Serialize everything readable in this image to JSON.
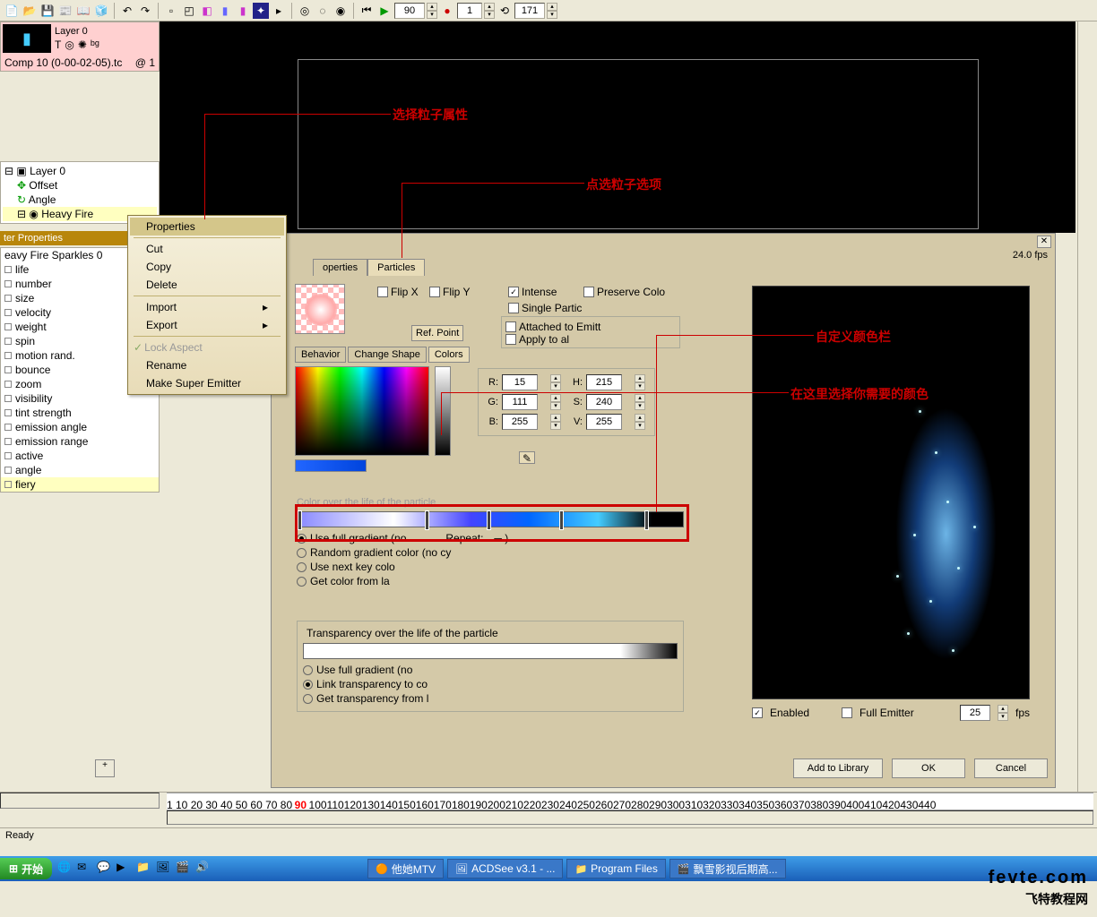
{
  "toolbar": {
    "frame_input": "90",
    "rec_input": "1",
    "frame2": "171"
  },
  "layer_panel": {
    "layer_name": "Layer 0",
    "comp": "Comp 10 (0-00-02-05).tc",
    "comp_at": "@ 1"
  },
  "tree": {
    "root": "Layer 0",
    "items": [
      "Offset",
      "Angle",
      "Heavy Fire "
    ]
  },
  "ctx": {
    "items": [
      "Properties",
      "Cut",
      "Copy",
      "Delete",
      "Import",
      "Export",
      "Lock Aspect",
      "Rename",
      "Make Super Emitter"
    ]
  },
  "prop_header": "ter Properties",
  "prop_title": "eavy Fire Sparkles 0",
  "props": [
    "life",
    "number",
    "size",
    "velocity",
    "weight",
    "spin",
    "motion rand.",
    "bounce",
    "zoom",
    "visibility",
    "tint strength",
    "emission angle",
    "emission range",
    "active",
    "angle",
    "fiery"
  ],
  "anno": {
    "a1": "选择粒子属性",
    "a2": "点选粒子选项",
    "a3": "自定义颜色栏",
    "a4": "在这里选择你需要的颜色"
  },
  "dialog": {
    "fps": "24.0 fps",
    "tabs": [
      "operties",
      "Particles"
    ],
    "flip_x": "Flip X",
    "flip_y": "Flip Y",
    "intense": "Intense",
    "preserve": "Preserve Colo",
    "single": "Single Partic",
    "attached": "Attached to Emitt",
    "apply": "Apply to al",
    "ref": "Ref. Point",
    "subtabs": [
      "Behavior",
      "Change Shape",
      "Colors"
    ],
    "rgb": {
      "R": "15",
      "G": "111",
      "B": "255",
      "H": "215",
      "S": "240",
      "V": "255"
    },
    "color_life_label": "Color over the life of the particle",
    "radios1": [
      "Use full gradient (no",
      "Random gradient color (no cy",
      "Use next key colo",
      "Get color from la"
    ],
    "repeat": "Repeat:",
    "trans_label": "Transparency over the life of the particle",
    "radios2": [
      "Use full gradient (no",
      "Link transparency to co",
      "Get transparency from l"
    ],
    "enabled": "Enabled",
    "full_emit": "Full Emitter",
    "fps_val": "25",
    "fps_lbl": "fps",
    "add_lib": "Add to Library",
    "ok": "OK",
    "cancel": "Cancel"
  },
  "timeline": {
    "marks": "1  10 20 30 40 50 60 70 80",
    "mark90": "90",
    "marks2": "100110120130140150160170180190200210220230240250260270280290300310320330340350360370380390400410420430440"
  },
  "status": "Ready",
  "taskbar": {
    "start": "开始",
    "items": [
      "他她MTV",
      "ACDSee v3.1 - ...",
      "Program Files",
      "飘雪影视后期高..."
    ]
  },
  "watermark": "fevte.com",
  "watermark2": "飞特教程网"
}
